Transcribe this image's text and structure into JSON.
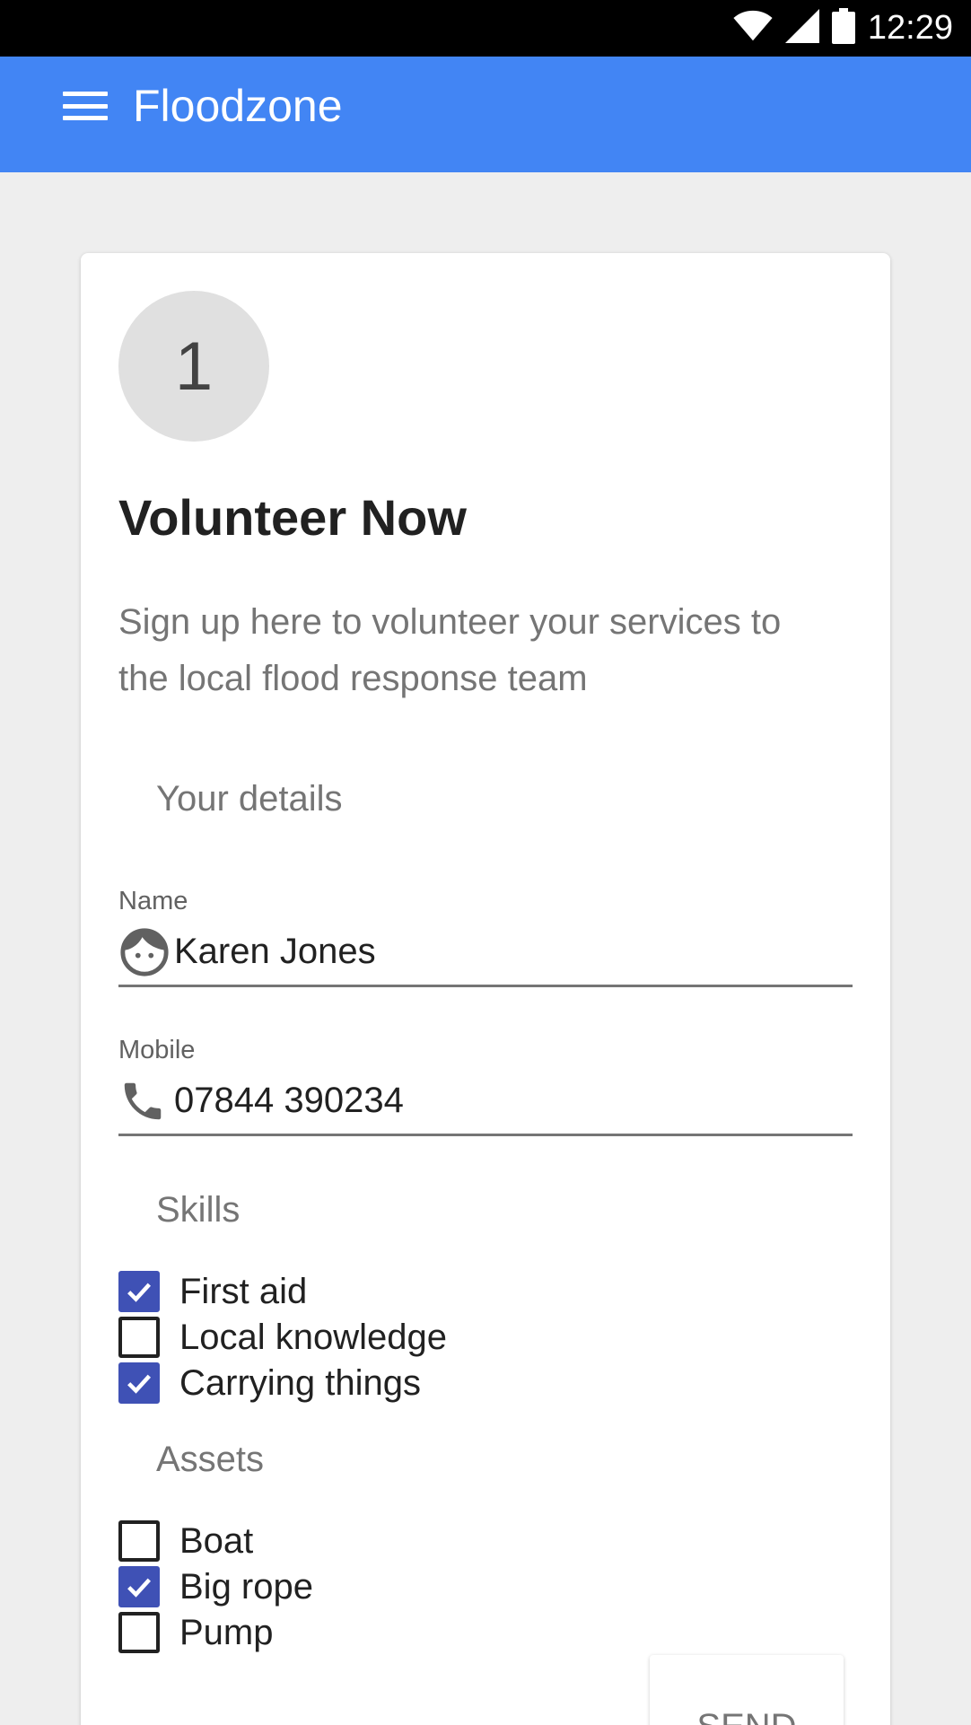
{
  "status_bar": {
    "time": "12:29",
    "icons": [
      "wifi-icon",
      "cellular-signal-icon",
      "battery-icon"
    ]
  },
  "app_bar": {
    "title": "Floodzone",
    "menu_icon": "hamburger-menu-icon",
    "color": "#4285f4"
  },
  "card": {
    "step_number": "1",
    "title": "Volunteer Now",
    "description": "Sign up here to volunteer your services to the local flood response team",
    "details_section": {
      "label": "Your details",
      "name_field": {
        "label": "Name",
        "value": "Karen Jones",
        "icon": "face-icon"
      },
      "mobile_field": {
        "label": "Mobile",
        "value": "07844 390234",
        "icon": "phone-icon"
      }
    },
    "skills": {
      "label": "Skills",
      "items": [
        {
          "label": "First aid",
          "checked": true
        },
        {
          "label": "Local knowledge",
          "checked": false
        },
        {
          "label": "Carrying things",
          "checked": true
        }
      ]
    },
    "assets": {
      "label": "Assets",
      "items": [
        {
          "label": "Boat",
          "checked": false
        },
        {
          "label": "Big rope",
          "checked": true
        },
        {
          "label": "Pump",
          "checked": false
        }
      ]
    },
    "send_button": {
      "label": "SEND"
    }
  },
  "colors": {
    "checkbox_checked": "#3f51b5",
    "background": "#eeeeee"
  }
}
